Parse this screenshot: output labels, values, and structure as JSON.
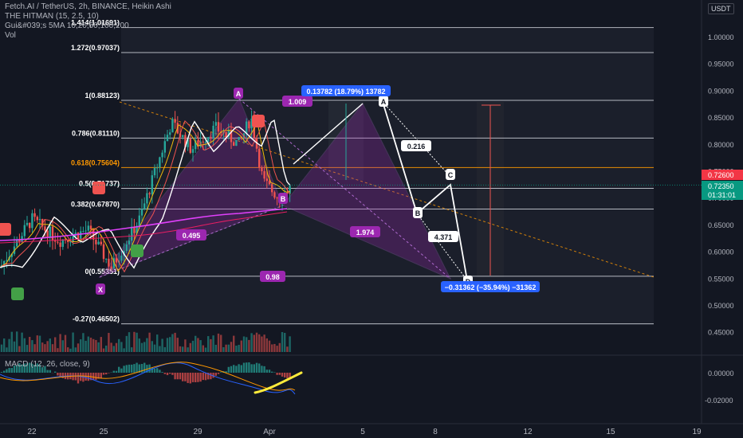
{
  "legend": {
    "symbol": "Fetch.AI / TetherUS, 2h, BINANCE, Heikin Ashi",
    "indicator1": "THE HITMAN (15, 2.5, 10)",
    "indicator2": "Gui&#039;s 5MA 10,20,50,100,200",
    "indicator3": "Vol",
    "macd": "MACD (12, 26, close, 9)",
    "currency": "USDT"
  },
  "colors": {
    "background": "#131722",
    "up_candle": "#26a69a",
    "down_candle": "#ef5350",
    "pattern_fill": "#9c27b0",
    "label_purple": "#9c27b0",
    "fib_orange": "#ff9800",
    "callout_blue": "#2962ff",
    "last_price_red": "#f23645",
    "last_price_teal": "#089981"
  },
  "chart_data": {
    "type": "candlestick",
    "price_axis": {
      "ticks": [
        "1.00000",
        "0.95000",
        "0.90000",
        "0.85000",
        "0.80000",
        "0.75000",
        "0.70000",
        "0.65000",
        "0.60000",
        "0.55000",
        "0.50000",
        "0.45000"
      ],
      "ylim": [
        0.43,
        1.05
      ]
    },
    "macd_axis": {
      "ticks": [
        "0.00000",
        "-0.02000"
      ]
    },
    "time_axis": {
      "ticks": [
        "22",
        "25",
        "29",
        "Apr",
        "5",
        "8",
        "12",
        "15",
        "19"
      ]
    },
    "fib_levels": [
      {
        "label": "1.414(1.01691)",
        "value": 1.01691
      },
      {
        "label": "1.272(0.97037)",
        "value": 0.97037
      },
      {
        "label": "1(0.88123)",
        "value": 0.88123
      },
      {
        "label": "0.786(0.81110)",
        "value": 0.8111
      },
      {
        "label": "0.618(0.75604)",
        "value": 0.75604
      },
      {
        "label": "0.5(0.71737)",
        "value": 0.71737
      },
      {
        "label": "0.382(0.67870)",
        "value": 0.6787
      },
      {
        "label": "0(0.55351)",
        "value": 0.55351
      },
      {
        "label": "-0.27(0.46502)",
        "value": 0.46502
      }
    ],
    "harmonic_labels": [
      "X",
      "A",
      "B",
      "0.495",
      "1.009",
      "1.974",
      "0.98"
    ],
    "projection_labels": [
      "A",
      "B",
      "C",
      "D",
      "0.216",
      "4.371"
    ],
    "callouts": {
      "up": "0.13782 (18.79%) 13782",
      "down": "−0.31362 (−35.94%) −31362"
    },
    "last_price": {
      "value": "0.72600",
      "value2": "0.72350",
      "countdown": "01:31:01"
    }
  }
}
